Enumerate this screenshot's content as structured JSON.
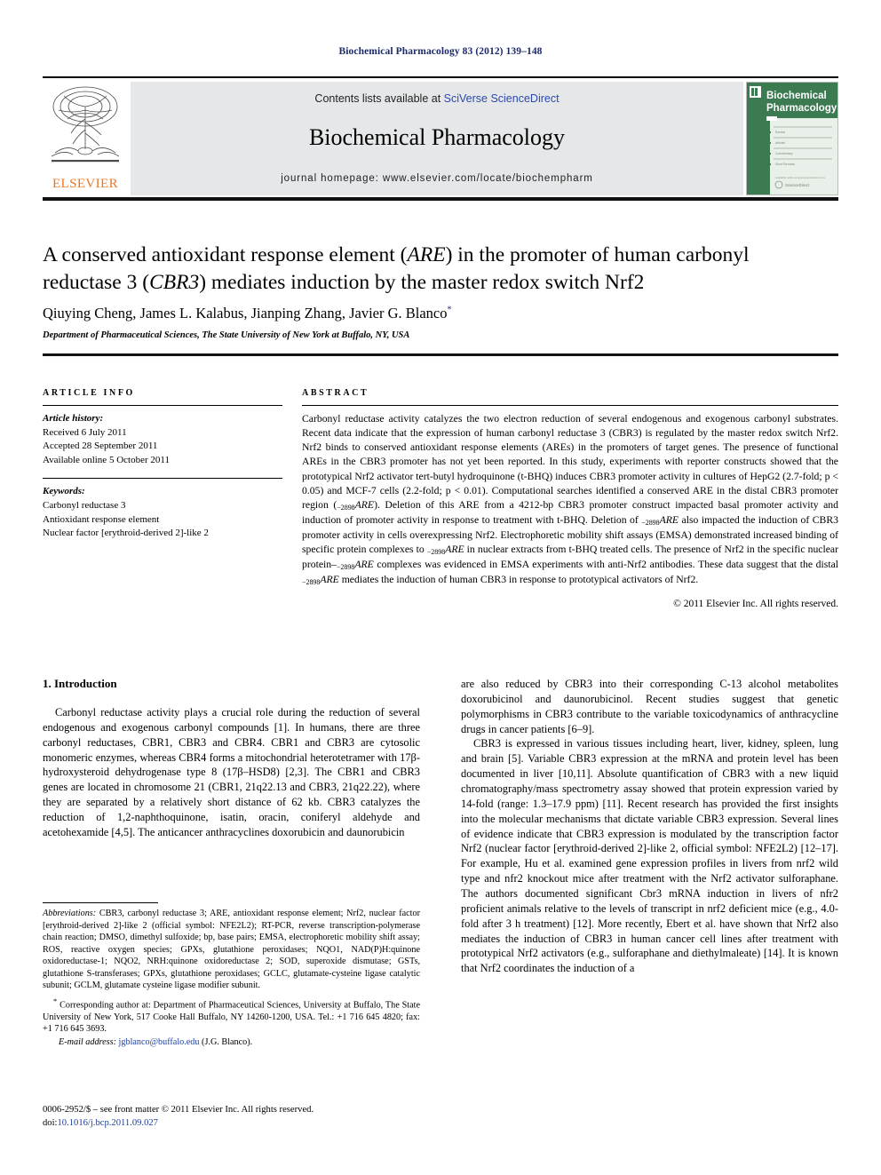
{
  "running_head": "Biochemical Pharmacology 83 (2012) 139–148",
  "masthead": {
    "publisher": "ELSEVIER",
    "contents_prefix": "Contents lists available at ",
    "contents_link": "SciVerse ScienceDirect",
    "journal_title": "Biochemical Pharmacology",
    "homepage": "journal homepage: www.elsevier.com/locate/biochempharm",
    "cover_line1": "Biochemical",
    "cover_line2": "Pharmacology",
    "cover_footer": "ScienceDirect",
    "colors": {
      "elsevier_orange": "#e87722",
      "link_blue": "#2b49b0",
      "masthead_grey": "#e6e7e8",
      "cover_green": "#3c7a52",
      "running_head_blue": "#1b2a6b"
    }
  },
  "article": {
    "title_part1": "A conserved antioxidant response element (",
    "title_em1": "ARE",
    "title_part2": ") in the promoter of human carbonyl reductase 3 (",
    "title_em2": "CBR3",
    "title_part3": ") mediates induction by the master redox switch Nrf2",
    "authors": "Qiuying Cheng, James L. Kalabus, Jianping Zhang, Javier G. Blanco",
    "corresponding_marker": "*",
    "affiliation": "Department of Pharmaceutical Sciences, The State University of New York at Buffalo, NY, USA"
  },
  "article_info": {
    "heading": "ARTICLE INFO",
    "history_label": "Article history:",
    "history": [
      "Received 6 July 2011",
      "Accepted 28 September 2011",
      "Available online 5 October 2011"
    ],
    "keywords_label": "Keywords:",
    "keywords": [
      "Carbonyl reductase 3",
      "Antioxidant response element",
      "Nuclear factor [erythroid-derived 2]-like 2"
    ]
  },
  "abstract": {
    "heading": "ABSTRACT",
    "text": "Carbonyl reductase activity catalyzes the two electron reduction of several endogenous and exogenous carbonyl substrates. Recent data indicate that the expression of human carbonyl reductase 3 (CBR3) is regulated by the master redox switch Nrf2. Nrf2 binds to conserved antioxidant response elements (AREs) in the promoters of target genes. The presence of functional AREs in the CBR3 promoter has not yet been reported. In this study, experiments with reporter constructs showed that the prototypical Nrf2 activator tert-butyl hydroquinone (t-BHQ) induces CBR3 promoter activity in cultures of HepG2 (2.7-fold; p < 0.05) and MCF-7 cells (2.2-fold; p < 0.01). Computational searches identified a conserved ARE in the distal CBR3 promoter region (−2898ARE). Deletion of this ARE from a 4212-bp CBR3 promoter construct impacted basal promoter activity and induction of promoter activity in response to treatment with t-BHQ. Deletion of −2898ARE also impacted the induction of CBR3 promoter activity in cells overexpressing Nrf2. Electrophoretic mobility shift assays (EMSA) demonstrated increased binding of specific protein complexes to −2898ARE in nuclear extracts from t-BHQ treated cells. The presence of Nrf2 in the specific nuclear protein–−2898ARE complexes was evidenced in EMSA experiments with anti-Nrf2 antibodies. These data suggest that the distal −2898ARE mediates the induction of human CBR3 in response to prototypical activators of Nrf2.",
    "copyright": "© 2011 Elsevier Inc. All rights reserved."
  },
  "introduction": {
    "section_number_title": "1. Introduction",
    "left_paragraphs": [
      "Carbonyl reductase activity plays a crucial role during the reduction of several endogenous and exogenous carbonyl compounds [1]. In humans, there are three carbonyl reductases, CBR1, CBR3 and CBR4. CBR1 and CBR3 are cytosolic monomeric enzymes, whereas CBR4 forms a mitochondrial heterotetramer with 17β-hydroxysteroid dehydrogenase type 8 (17β–HSD8) [2,3]. The CBR1 and CBR3 genes are located in chromosome 21 (CBR1, 21q22.13 and CBR3, 21q22.22), where they are separated by a relatively short distance of 62 kb. CBR3 catalyzes the reduction of 1,2-naphthoquinone, isatin, oracin, coniferyl aldehyde and acetohexamide [4,5]. The anticancer anthracyclines doxorubicin and daunorubicin"
    ],
    "right_paragraphs": [
      "are also reduced by CBR3 into their corresponding C-13 alcohol metabolites doxorubicinol and daunorubicinol. Recent studies suggest that genetic polymorphisms in CBR3 contribute to the variable toxicodynamics of anthracycline drugs in cancer patients [6–9].",
      "CBR3 is expressed in various tissues including heart, liver, kidney, spleen, lung and brain [5]. Variable CBR3 expression at the mRNA and protein level has been documented in liver [10,11]. Absolute quantification of CBR3 with a new liquid chromatography/mass spectrometry assay showed that protein expression varied by 14-fold (range: 1.3–17.9 ppm) [11]. Recent research has provided the first insights into the molecular mechanisms that dictate variable CBR3 expression. Several lines of evidence indicate that CBR3 expression is modulated by the transcription factor Nrf2 (nuclear factor [erythroid-derived 2]-like 2, official symbol: NFE2L2) [12–17]. For example, Hu et al. examined gene expression profiles in livers from nrf2 wild type and nfr2 knockout mice after treatment with the Nrf2 activator sulforaphane. The authors documented significant Cbr3 mRNA induction in livers of nfr2 proficient animals relative to the levels of transcript in nrf2 deficient mice (e.g., 4.0-fold after 3 h treatment) [12]. More recently, Ebert et al. have shown that Nrf2 also mediates the induction of CBR3 in human cancer cell lines after treatment with prototypical Nrf2 activators (e.g., sulforaphane and diethylmaleate) [14]. It is known that Nrf2 coordinates the induction of a"
    ]
  },
  "footnotes": {
    "abbreviations_label": "Abbreviations:",
    "abbreviations_text": "CBR3, carbonyl reductase 3; ARE, antioxidant response element; Nrf2, nuclear factor [erythroid-derived 2]-like 2 (official symbol: NFE2L2); RT-PCR, reverse transcription-polymerase chain reaction; DMSO, dimethyl sulfoxide; bp, base pairs; EMSA, electrophoretic mobility shift assay; ROS, reactive oxygen species; GPXs, glutathione peroxidases; NQO1, NAD(P)H:quinone oxidoreductase-1; NQO2, NRH:quinone oxidoreductase 2; SOD, superoxide dismutase; GSTs, glutathione S-transferases; GPXs, glutathione peroxidases; GCLC, glutamate-cysteine ligase catalytic subunit; GCLM, glutamate cysteine ligase modifier subunit.",
    "corresponding_marker": "*",
    "corresponding_text": "Corresponding author at: Department of Pharmaceutical Sciences, University at Buffalo, The State University of New York, 517 Cooke Hall Buffalo, NY 14260-1200, USA. Tel.: +1 716 645 4820; fax: +1 716 645 3693.",
    "email_label": "E-mail address:",
    "email": "jgblanco@buffalo.edu",
    "email_suffix": "(J.G. Blanco)."
  },
  "frontmatter": {
    "line1": "0006-2952/$ – see front matter © 2011 Elsevier Inc. All rights reserved.",
    "doi_label": "doi:",
    "doi": "10.1016/j.bcp.2011.09.027"
  }
}
